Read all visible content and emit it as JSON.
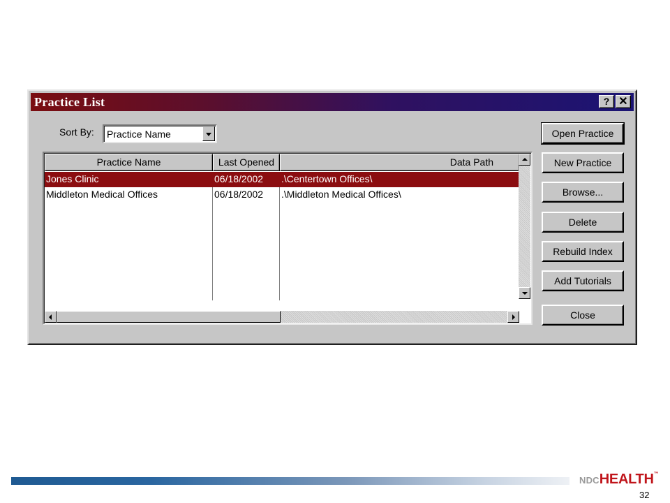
{
  "window": {
    "title": "Practice List",
    "help_glyph": "?",
    "close_glyph": "✕"
  },
  "sort": {
    "label": "Sort By:",
    "selected": "Practice Name"
  },
  "list": {
    "columns": [
      "Practice Name",
      "Last Opened",
      "Data Path"
    ],
    "rows": [
      {
        "name": "Jones Clinic",
        "last_opened": "06/18/2002",
        "path": ".\\Centertown Offices\\",
        "selected": true
      },
      {
        "name": "Middleton Medical Offices",
        "last_opened": "06/18/2002",
        "path": ".\\Middleton Medical Offices\\",
        "selected": false
      }
    ],
    "selection_color": "#8b0d10"
  },
  "buttons": {
    "open": "Open Practice",
    "new": "New Practice",
    "browse": "Browse...",
    "delete": "Delete",
    "rebuild": "Rebuild Index",
    "tutorials": "Add Tutorials",
    "close": "Close"
  },
  "footer": {
    "logo_ndc": "NDC",
    "logo_health": "HEALTH",
    "logo_tm": "™",
    "page_number": "32",
    "logo_color": "#c0151b"
  }
}
